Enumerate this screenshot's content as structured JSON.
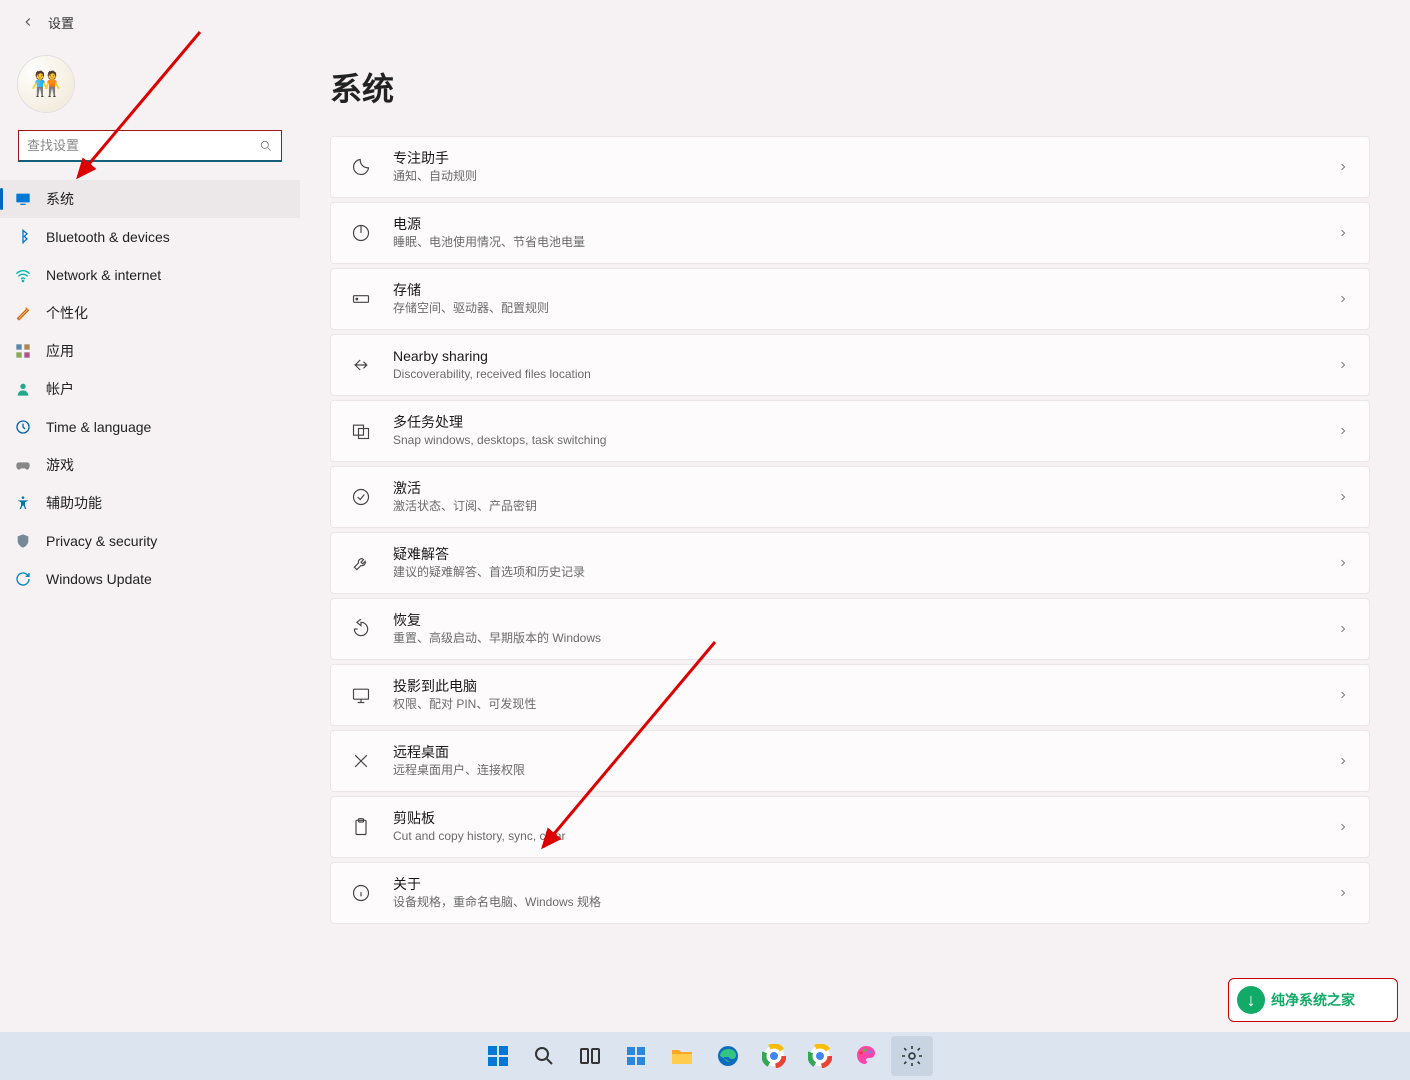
{
  "header": {
    "title": "设置"
  },
  "search": {
    "placeholder": "查找设置"
  },
  "nav": [
    {
      "id": "system",
      "label": "系统",
      "active": true
    },
    {
      "id": "bluetooth",
      "label": "Bluetooth & devices"
    },
    {
      "id": "network",
      "label": "Network & internet"
    },
    {
      "id": "personalization",
      "label": "个性化"
    },
    {
      "id": "apps",
      "label": "应用"
    },
    {
      "id": "accounts",
      "label": "帐户"
    },
    {
      "id": "time",
      "label": "Time & language"
    },
    {
      "id": "gaming",
      "label": "游戏"
    },
    {
      "id": "accessibility",
      "label": "辅助功能"
    },
    {
      "id": "privacy",
      "label": "Privacy & security"
    },
    {
      "id": "update",
      "label": "Windows Update"
    }
  ],
  "page": {
    "title": "系统"
  },
  "cards": [
    {
      "id": "focus",
      "title": "专注助手",
      "sub": "通知、自动规则"
    },
    {
      "id": "power",
      "title": "电源",
      "sub": "睡眠、电池使用情况、节省电池电量"
    },
    {
      "id": "storage",
      "title": "存储",
      "sub": "存储空间、驱动器、配置规则"
    },
    {
      "id": "nearby",
      "title": "Nearby sharing",
      "sub": "Discoverability, received files location"
    },
    {
      "id": "multitask",
      "title": "多任务处理",
      "sub": "Snap windows, desktops, task switching"
    },
    {
      "id": "activation",
      "title": "激活",
      "sub": "激活状态、订阅、产品密钥"
    },
    {
      "id": "troubleshoot",
      "title": "疑难解答",
      "sub": "建议的疑难解答、首选项和历史记录"
    },
    {
      "id": "recovery",
      "title": "恢复",
      "sub": "重置、高级启动、早期版本的 Windows"
    },
    {
      "id": "project",
      "title": "投影到此电脑",
      "sub": "权限、配对 PIN、可发现性"
    },
    {
      "id": "remote",
      "title": "远程桌面",
      "sub": "远程桌面用户、连接权限"
    },
    {
      "id": "clipboard",
      "title": "剪贴板",
      "sub": "Cut and copy history, sync, clear"
    },
    {
      "id": "about",
      "title": "关于",
      "sub": "设备规格，重命名电脑、Windows 规格"
    }
  ],
  "watermark": {
    "text": "纯净系统之家"
  }
}
